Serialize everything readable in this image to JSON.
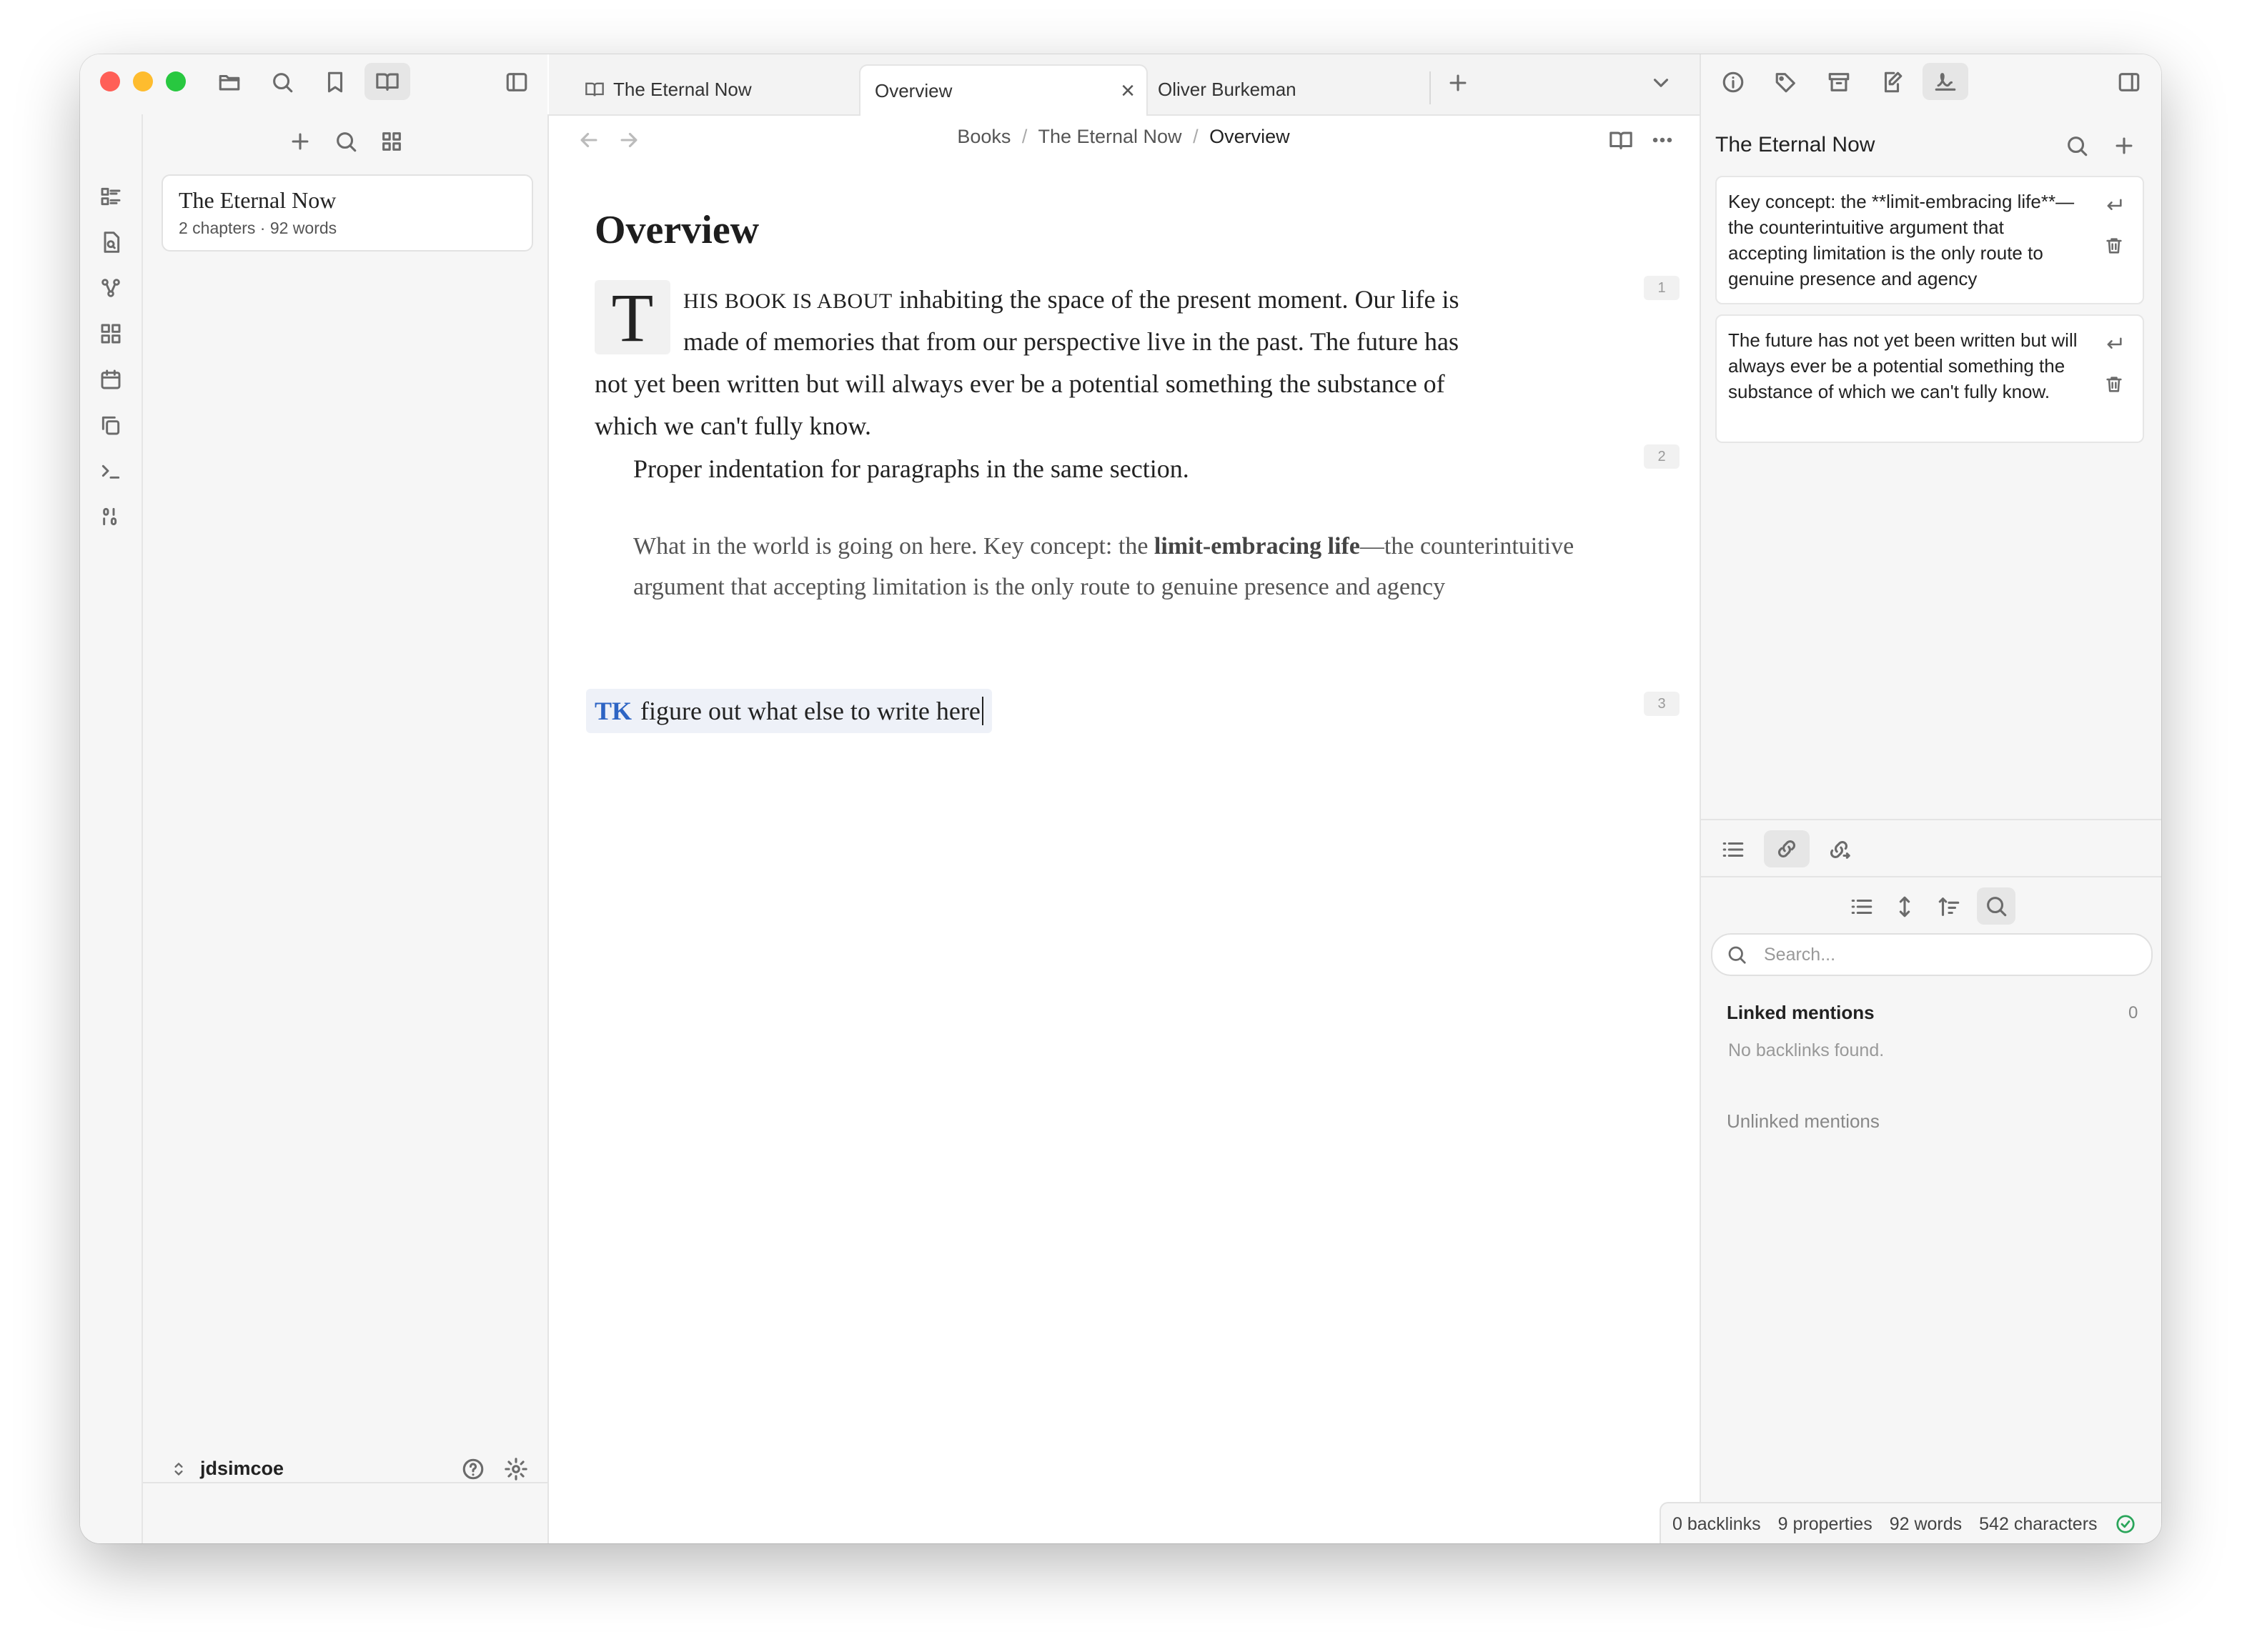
{
  "tabs": [
    {
      "label": "The Eternal Now",
      "icon": "book-open-icon"
    },
    {
      "label": "Overview",
      "close": "×"
    },
    {
      "label": "Oliver Burkeman"
    }
  ],
  "left_panel": {
    "file_card": {
      "title": "The Eternal Now",
      "meta": "2 chapters · 92 words"
    },
    "vault_name": "jdsimcoe"
  },
  "breadcrumb": {
    "part1": "Books",
    "part2": "The Eternal Now",
    "current": "Overview",
    "sep": "/"
  },
  "document": {
    "heading": "Overview",
    "dropcap": "T",
    "para1_smallcaps": "HIS BOOK IS ABOUT",
    "para1_line1_rest": " inhabiting the space of the present moment. Our life is",
    "para1_line2": "made of memories that from our perspective live in the past. The future has",
    "para1_line3": "not yet been written but will always ever be a potential something the substance of",
    "para1_line4": "which we can't fully know.",
    "para1_line5": "Proper indentation for paragraphs in the same section.",
    "quote_pre": "What in the world is going on here. Key concept: the ",
    "quote_bold": "limit-embracing life",
    "quote_post": "—the counterintuitive argument that accepting limitation is the only route to genuine presence and agency",
    "tk_label": "TK",
    "tk_text": "figure out what else to write here",
    "line_numbers": [
      "1",
      "2",
      "3"
    ]
  },
  "right_panel": {
    "title": "The Eternal Now",
    "highlights": [
      {
        "text": "Key concept: the **limit-embracing life**—the counterintuitive argument that accepting limitation is the only route to genuine presence and agency"
      },
      {
        "text": "The future has not yet been written but will always ever be a potential something the substance of which we can't fully know."
      }
    ],
    "search_placeholder": "Search...",
    "linked_mentions_label": "Linked mentions",
    "linked_mentions_count": "0",
    "no_backlinks": "No backlinks found.",
    "unlinked_mentions_label": "Unlinked mentions"
  },
  "status_bar": {
    "backlinks": "0 backlinks",
    "properties": "9 properties",
    "words": "92 words",
    "characters": "542 characters"
  },
  "colors": {
    "accent_tk": "#2d64c4",
    "status_ok": "#2aa55a"
  }
}
